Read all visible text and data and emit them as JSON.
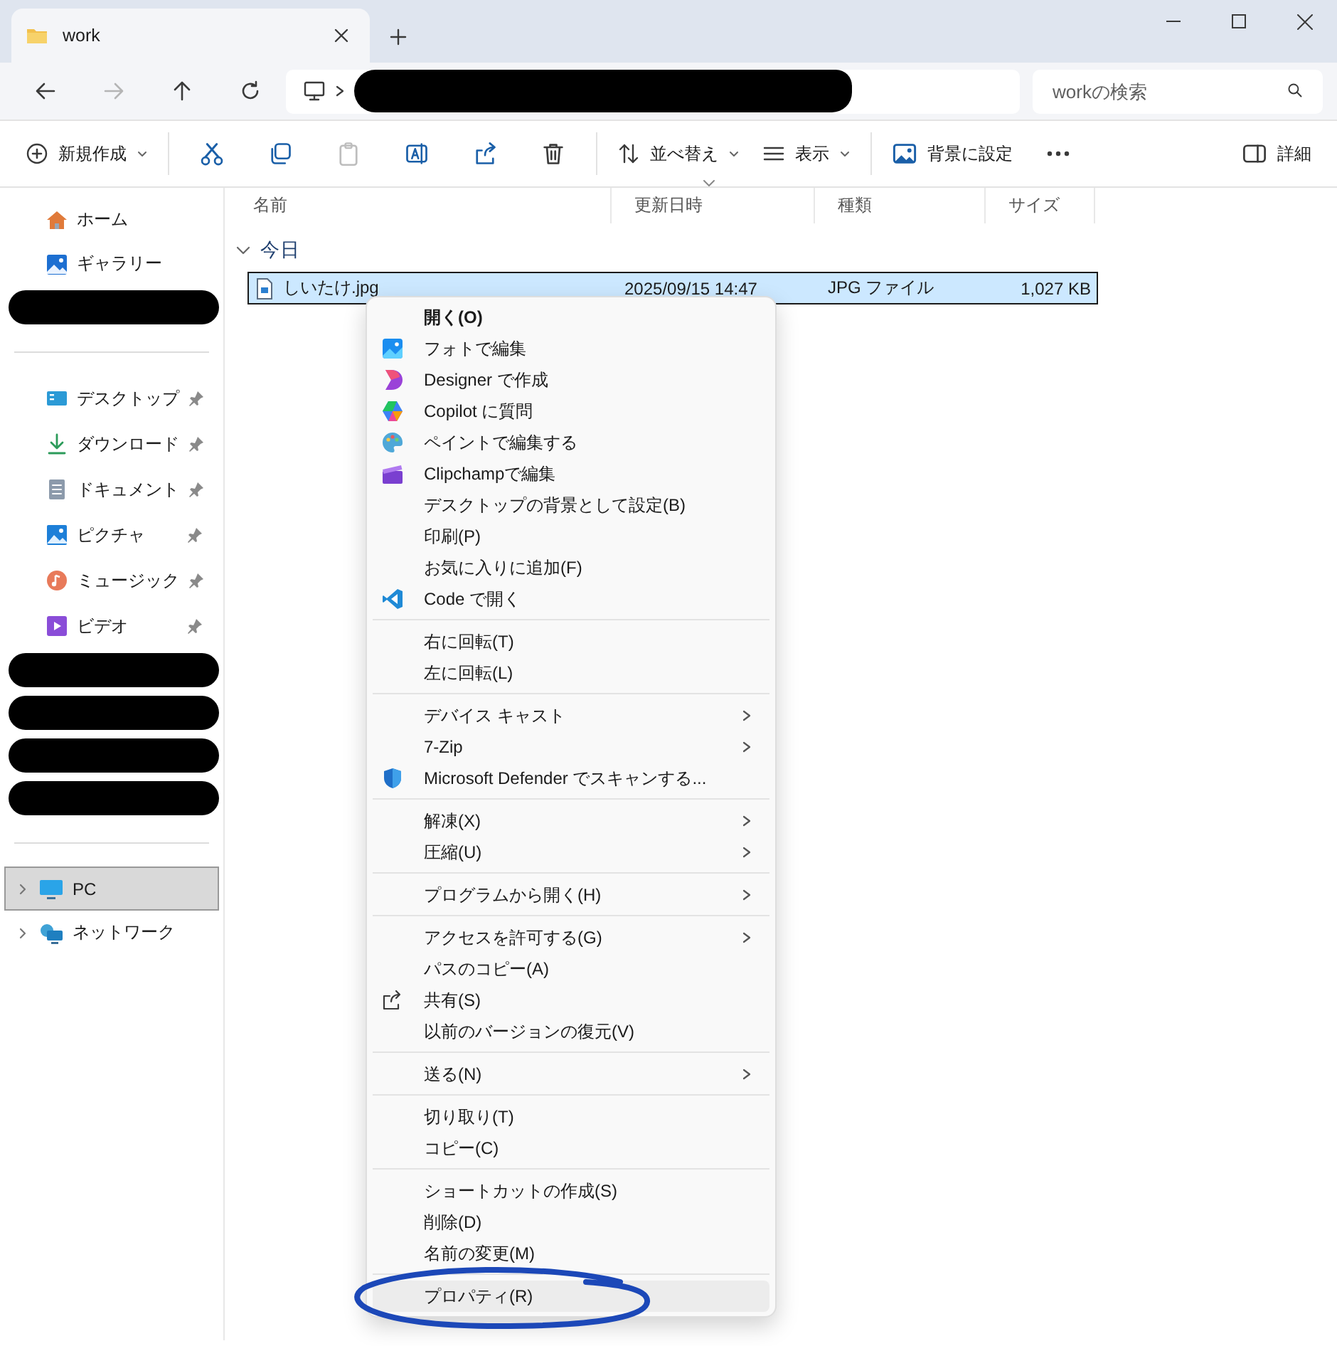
{
  "window": {
    "tab": {
      "title": "work"
    }
  },
  "nav": [
    {
      "kind": "back",
      "disabled": false
    },
    {
      "kind": "forward",
      "disabled": true
    },
    {
      "kind": "up",
      "disabled": false
    },
    {
      "kind": "refresh",
      "disabled": false
    }
  ],
  "address": {
    "path_redacted": true
  },
  "search": {
    "placeholder": "workの検索"
  },
  "toolbar": [
    {
      "kind": "new",
      "label": "新規作成",
      "dropdown": true,
      "disabled": false
    },
    {
      "kind": "cut",
      "disabled": false
    },
    {
      "kind": "copy",
      "disabled": false
    },
    {
      "kind": "paste",
      "disabled": true
    },
    {
      "kind": "rename",
      "disabled": false
    },
    {
      "kind": "share",
      "disabled": false
    },
    {
      "kind": "delete",
      "disabled": false
    },
    {
      "kind": "sort",
      "label": "並べ替え",
      "dropdown": true,
      "disabled": false
    },
    {
      "kind": "view",
      "label": "表示",
      "dropdown": true,
      "disabled": false
    },
    {
      "kind": "wallpaper",
      "label": "背景に設定",
      "dropdown": false,
      "disabled": false
    },
    {
      "kind": "more",
      "disabled": false
    },
    {
      "kind": "details",
      "label": "詳細",
      "dropdown": false,
      "disabled": false
    }
  ],
  "sidebar": {
    "sections": [
      {
        "items": [
          {
            "kind": "folder",
            "label": "ホーム",
            "selected": false
          },
          {
            "kind": "folder",
            "label": "ギャラリー",
            "selected": false
          },
          {
            "kind": "redacted",
            "selected": false
          }
        ]
      },
      {
        "items": [
          {
            "kind": "folder",
            "label": "デスクトップ",
            "selected": false,
            "pinned": true
          },
          {
            "kind": "folder",
            "label": "ダウンロード",
            "selected": false,
            "pinned": true
          },
          {
            "kind": "folder",
            "label": "ドキュメント",
            "selected": false,
            "pinned": true
          },
          {
            "kind": "folder",
            "label": "ピクチャ",
            "selected": false,
            "pinned": true
          },
          {
            "kind": "folder",
            "label": "ミュージック",
            "selected": false,
            "pinned": true
          },
          {
            "kind": "folder",
            "label": "ビデオ",
            "selected": false,
            "pinned": true
          },
          {
            "kind": "redacted",
            "selected": false
          },
          {
            "kind": "redacted",
            "selected": false
          },
          {
            "kind": "redacted",
            "selected": false
          },
          {
            "kind": "redacted",
            "selected": false
          }
        ]
      },
      {
        "items": [
          {
            "kind": "folder",
            "label": "PC",
            "selected": true,
            "expanded": false
          },
          {
            "kind": "folder",
            "label": "ネットワーク",
            "selected": false,
            "expanded": false
          }
        ]
      }
    ]
  },
  "table": {
    "columns": [
      {
        "label": "名前",
        "sorted": false
      },
      {
        "label": "更新日時",
        "sorted": true
      },
      {
        "label": "種類",
        "sorted": false
      },
      {
        "label": "サイズ",
        "sorted": false
      }
    ],
    "groups": [
      {
        "label": "今日",
        "expanded": true,
        "rows": [
          {
            "selected": true,
            "cells": [
              "しいたけ.jpg",
              "2025/09/15 14:47",
              "JPG ファイル",
              "1,027 KB"
            ]
          }
        ]
      }
    ]
  },
  "context_menu": {
    "groups": [
      [
        {
          "label": "開く(O)",
          "default": true,
          "submenu": false,
          "selected": false,
          "circled": false
        },
        {
          "label": "フォトで編集",
          "default": false,
          "submenu": false,
          "selected": false,
          "circled": false
        },
        {
          "label": "Designer で作成",
          "default": false,
          "submenu": false,
          "selected": false,
          "circled": false
        },
        {
          "label": "Copilot に質問",
          "default": false,
          "submenu": false,
          "selected": false,
          "circled": false
        },
        {
          "label": "ペイントで編集する",
          "default": false,
          "submenu": false,
          "selected": false,
          "circled": false
        },
        {
          "label": "Clipchampで編集",
          "default": false,
          "submenu": false,
          "selected": false,
          "circled": false
        },
        {
          "label": "デスクトップの背景として設定(B)",
          "default": false,
          "submenu": false,
          "selected": false,
          "circled": false
        },
        {
          "label": "印刷(P)",
          "default": false,
          "submenu": false,
          "selected": false,
          "circled": false
        },
        {
          "label": "お気に入りに追加(F)",
          "default": false,
          "submenu": false,
          "selected": false,
          "circled": false
        },
        {
          "label": "Code で開く",
          "default": false,
          "submenu": false,
          "selected": false,
          "circled": false
        }
      ],
      [
        {
          "label": "右に回転(T)",
          "default": false,
          "submenu": false,
          "selected": false,
          "circled": false
        },
        {
          "label": "左に回転(L)",
          "default": false,
          "submenu": false,
          "selected": false,
          "circled": false
        }
      ],
      [
        {
          "label": "デバイス キャスト",
          "default": false,
          "submenu": true,
          "selected": false,
          "circled": false
        },
        {
          "label": "7-Zip",
          "default": false,
          "submenu": true,
          "selected": false,
          "circled": false
        },
        {
          "label": "Microsoft Defender でスキャンする...",
          "default": false,
          "submenu": false,
          "selected": false,
          "circled": false
        }
      ],
      [
        {
          "label": "解凍(X)",
          "default": false,
          "submenu": true,
          "selected": false,
          "circled": false
        },
        {
          "label": "圧縮(U)",
          "default": false,
          "submenu": true,
          "selected": false,
          "circled": false
        }
      ],
      [
        {
          "label": "プログラムから開く(H)",
          "default": false,
          "submenu": true,
          "selected": false,
          "circled": false
        }
      ],
      [
        {
          "label": "アクセスを許可する(G)",
          "default": false,
          "submenu": true,
          "selected": false,
          "circled": false
        },
        {
          "label": "パスのコピー(A)",
          "default": false,
          "submenu": false,
          "selected": false,
          "circled": false
        },
        {
          "label": "共有(S)",
          "default": false,
          "submenu": false,
          "selected": false,
          "circled": false
        },
        {
          "label": "以前のバージョンの復元(V)",
          "default": false,
          "submenu": false,
          "selected": false,
          "circled": false
        }
      ],
      [
        {
          "label": "送る(N)",
          "default": false,
          "submenu": true,
          "selected": false,
          "circled": false
        }
      ],
      [
        {
          "label": "切り取り(T)",
          "default": false,
          "submenu": false,
          "selected": false,
          "circled": false
        },
        {
          "label": "コピー(C)",
          "default": false,
          "submenu": false,
          "selected": false,
          "circled": false
        }
      ],
      [
        {
          "label": "ショートカットの作成(S)",
          "default": false,
          "submenu": false,
          "selected": false,
          "circled": false
        },
        {
          "label": "削除(D)",
          "default": false,
          "submenu": false,
          "selected": false,
          "circled": false
        },
        {
          "label": "名前の変更(M)",
          "default": false,
          "submenu": false,
          "selected": false,
          "circled": false
        }
      ],
      [
        {
          "label": "プロパティ(R)",
          "default": false,
          "submenu": false,
          "selected": true,
          "circled": true
        }
      ]
    ]
  }
}
